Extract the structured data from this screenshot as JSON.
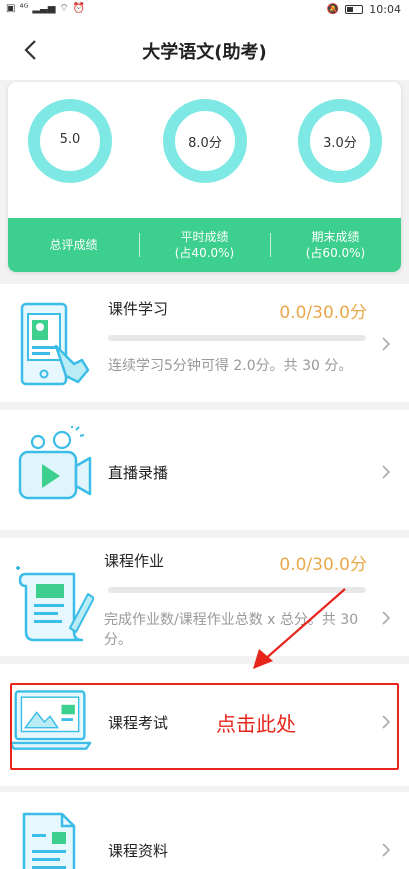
{
  "status_bar": {
    "network_left": "⁴ᴳ",
    "time": "10:04",
    "battery_level": 0.4
  },
  "header": {
    "title": "大学语文(助考)",
    "back_icon": "chevron-left-icon"
  },
  "score_summary": {
    "rings": [
      {
        "value": "5.0"
      },
      {
        "value": "8.0分"
      },
      {
        "value": "3.0分"
      }
    ],
    "band": {
      "total_label": "总评成绩",
      "usual_label": "平时成绩",
      "usual_weight": "(占40.0%)",
      "final_label": "期末成绩",
      "final_weight": "(占60.0%)"
    },
    "ring_color": "#7ee8e4",
    "band_color": "#3ccf8e"
  },
  "items": [
    {
      "title": "课件学习",
      "score": "0.0/30.0分",
      "progress": 0,
      "desc": "连续学习5分钟可得 2.0分。共 30 分。",
      "icon": "tablet-touch-icon"
    },
    {
      "title": "直播录播",
      "icon": "video-camera-icon"
    },
    {
      "title": "课程作业",
      "score": "0.0/30.0分",
      "progress": 0,
      "desc": "完成作业数/课程作业总数 x 总分。共 30分。",
      "icon": "homework-scroll-icon"
    },
    {
      "title": "课程考试",
      "icon": "laptop-exam-icon"
    },
    {
      "title": "课程资料",
      "icon": "document-icon"
    }
  ],
  "annotation": {
    "text": "点击此处",
    "color": "#e8251b"
  },
  "colors": {
    "accent_green": "#3ccf8e",
    "score_orange": "#e9a84a",
    "icon_cyan": "#3bbde8"
  }
}
